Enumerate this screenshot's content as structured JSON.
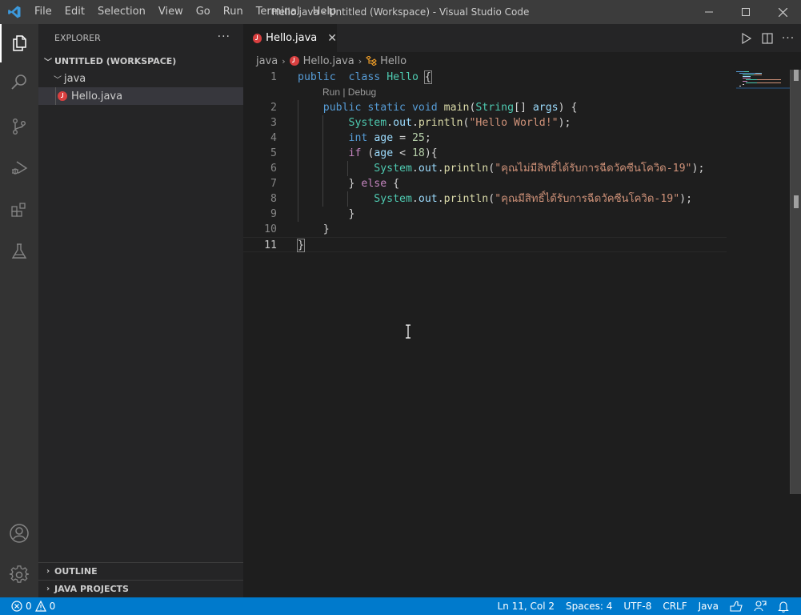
{
  "window": {
    "title": "Hello.java - Untitled (Workspace) - Visual Studio Code",
    "menu": [
      "File",
      "Edit",
      "Selection",
      "View",
      "Go",
      "Run",
      "Terminal",
      "Help"
    ]
  },
  "activity_bar": {
    "items": [
      "explorer-icon",
      "search-icon",
      "source-control-icon",
      "run-debug-icon",
      "extensions-icon",
      "testing-icon"
    ],
    "bottom": [
      "account-icon",
      "settings-gear-icon"
    ],
    "active": "explorer-icon"
  },
  "sidebar": {
    "title": "EXPLORER",
    "more": "···",
    "workspace": "UNTITLED (WORKSPACE)",
    "folder": "java",
    "file": "Hello.java",
    "panels": [
      "OUTLINE",
      "JAVA PROJECTS"
    ]
  },
  "editor": {
    "tab": {
      "label": "Hello.java",
      "close": "✕"
    },
    "breadcrumbs": [
      "java",
      "Hello.java",
      "Hello"
    ],
    "codelens": "Run | Debug",
    "lines": [
      {
        "n": "1",
        "tokens": [
          [
            "kw",
            "public"
          ],
          [
            "",
            "  "
          ],
          [
            "kw",
            "class"
          ],
          [
            "",
            " "
          ],
          [
            "type",
            "Hello"
          ],
          [
            "",
            " "
          ],
          [
            "bm",
            "{"
          ]
        ]
      },
      {
        "n": "2",
        "tokens": [
          [
            "",
            "    "
          ],
          [
            "kw",
            "public"
          ],
          [
            "",
            " "
          ],
          [
            "kw",
            "static"
          ],
          [
            "",
            " "
          ],
          [
            "kw",
            "void"
          ],
          [
            "",
            " "
          ],
          [
            "fn",
            "main"
          ],
          [
            "",
            "("
          ],
          [
            "type",
            "String"
          ],
          [
            "",
            "[] "
          ],
          [
            "var",
            "args"
          ],
          [
            "",
            ") {"
          ]
        ]
      },
      {
        "n": "3",
        "tokens": [
          [
            "",
            "        "
          ],
          [
            "type",
            "System"
          ],
          [
            "",
            "."
          ],
          [
            "var",
            "out"
          ],
          [
            "",
            "."
          ],
          [
            "fn",
            "println"
          ],
          [
            "",
            "("
          ],
          [
            "str",
            "\"Hello World!\""
          ],
          [
            "",
            ");"
          ]
        ]
      },
      {
        "n": "4",
        "tokens": [
          [
            "",
            "        "
          ],
          [
            "kw",
            "int"
          ],
          [
            "",
            " "
          ],
          [
            "var",
            "age"
          ],
          [
            "",
            " = "
          ],
          [
            "num",
            "25"
          ],
          [
            "",
            ";"
          ]
        ]
      },
      {
        "n": "5",
        "tokens": [
          [
            "",
            "        "
          ],
          [
            "kw2",
            "if"
          ],
          [
            "",
            " ("
          ],
          [
            "var",
            "age"
          ],
          [
            "",
            " < "
          ],
          [
            "num",
            "18"
          ],
          [
            "",
            "){"
          ]
        ]
      },
      {
        "n": "6",
        "tokens": [
          [
            "",
            "            "
          ],
          [
            "type",
            "System"
          ],
          [
            "",
            "."
          ],
          [
            "var",
            "out"
          ],
          [
            "",
            "."
          ],
          [
            "fn",
            "println"
          ],
          [
            "",
            "("
          ],
          [
            "str",
            "\"คุณไม่มีสิทธิ์ได้รับการฉีดวัคซีนโควิด-19\""
          ],
          [
            "",
            ");"
          ]
        ]
      },
      {
        "n": "7",
        "tokens": [
          [
            "",
            "        } "
          ],
          [
            "kw2",
            "else"
          ],
          [
            "",
            " {"
          ]
        ]
      },
      {
        "n": "8",
        "tokens": [
          [
            "",
            "            "
          ],
          [
            "type",
            "System"
          ],
          [
            "",
            "."
          ],
          [
            "var",
            "out"
          ],
          [
            "",
            "."
          ],
          [
            "fn",
            "println"
          ],
          [
            "",
            "("
          ],
          [
            "str",
            "\"คุณมีสิทธิ์ได้รับการฉีดวัคซีนโควิด-19\""
          ],
          [
            "",
            ");"
          ]
        ]
      },
      {
        "n": "9",
        "tokens": [
          [
            "",
            "        }"
          ]
        ]
      },
      {
        "n": "10",
        "tokens": [
          [
            "",
            "    }"
          ]
        ]
      },
      {
        "n": "11",
        "tokens": [
          [
            "bm",
            "}"
          ]
        ]
      }
    ],
    "actions": [
      "run-icon",
      "split-editor-icon",
      "more-actions-icon"
    ]
  },
  "status_bar": {
    "errors": "0",
    "warnings": "0",
    "position": "Ln 11, Col 2",
    "spaces": "Spaces: 4",
    "encoding": "UTF-8",
    "eol": "CRLF",
    "language": "Java"
  }
}
